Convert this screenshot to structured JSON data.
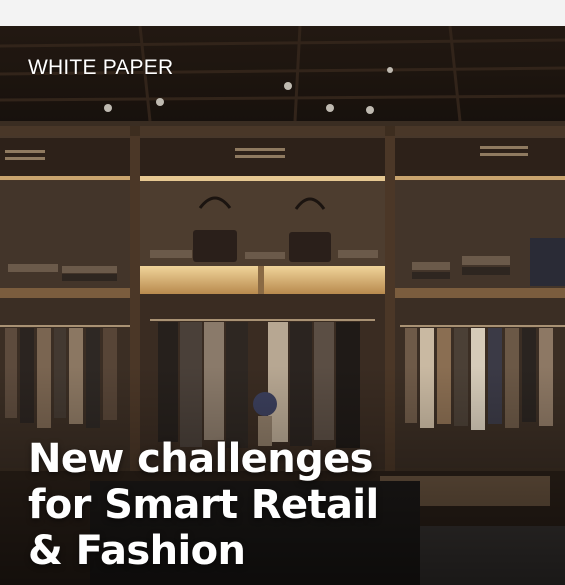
{
  "card": {
    "eyebrow": "WHITE PAPER",
    "headline_lines": [
      "New challenges",
      "for Smart Retail",
      "& Fashion"
    ],
    "image_subject": "boutique-interior-photo"
  },
  "colors": {
    "text": "#ffffff",
    "wood": "#3a2a1e",
    "shelf_light": "#d9b67a",
    "page_bg": "#f2f2f2"
  }
}
